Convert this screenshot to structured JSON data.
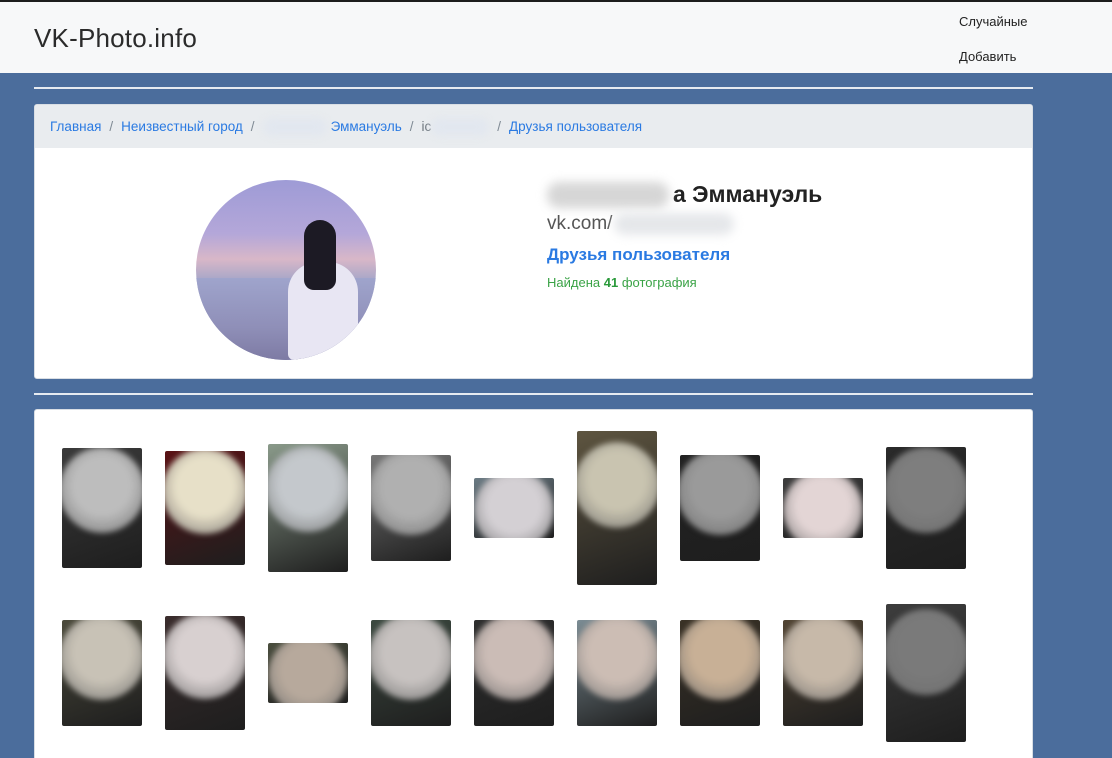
{
  "navbar": {
    "brand": "VK-Photo.info",
    "links": [
      "Случайные",
      "Добавить"
    ]
  },
  "breadcrumb": {
    "home": "Главная",
    "city": "Неизвестный город",
    "name_fragment": "Эммануэль",
    "id_fragment": "ic",
    "current": "Друзья пользователя",
    "separator": "/"
  },
  "profile": {
    "name_visible": "а Эммануэль",
    "vk_prefix": "vk.com/",
    "friends_link": "Друзья пользователя",
    "found_prefix": "Найдена",
    "found_count": "41",
    "found_suffix": "фотография"
  },
  "colors": {
    "page_background": "#4b6d9c",
    "link": "#2a7ae2",
    "success": "#3aa346"
  },
  "photos": [
    {
      "bg": "#3a3a3a",
      "face": "#bdbdbd"
    },
    {
      "bg": "#5a1215",
      "face": "#e7e0c8"
    },
    {
      "bg": "#8a9a8a",
      "face": "#c4c8cc"
    },
    {
      "bg": "#777777",
      "face": "#b0b0b0"
    },
    {
      "bg": "#6b7b84",
      "face": "#d4d0d4"
    },
    {
      "bg": "#5e5540",
      "face": "#c9c4b0"
    },
    {
      "bg": "#222222",
      "face": "#9a9a9a"
    },
    {
      "bg": "#3d3d3d",
      "face": "#e3d5d5"
    },
    {
      "bg": "#2a2a2a",
      "face": "#7e7e7e"
    },
    {
      "bg": "#4b4a3b",
      "face": "#c8c2b6"
    },
    {
      "bg": "#3a2c2c",
      "face": "#d8d0d0"
    },
    {
      "bg": "#4a4e3e",
      "face": "#b7a99c"
    },
    {
      "bg": "#3c4a40",
      "face": "#c7c2c0"
    },
    {
      "bg": "#2e2e2e",
      "face": "#cbbcb6"
    },
    {
      "bg": "#7b8c94",
      "face": "#ccbdb4"
    },
    {
      "bg": "#3a3226",
      "face": "#c8b096"
    },
    {
      "bg": "#514433",
      "face": "#c7b9a9"
    },
    {
      "bg": "#3d3d3d",
      "face": "#7a7a7a"
    }
  ]
}
